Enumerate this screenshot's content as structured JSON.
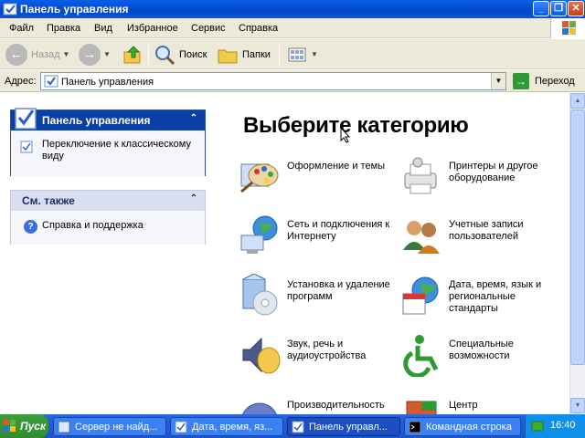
{
  "window": {
    "title": "Панель управления",
    "controls": {
      "minimize": "_",
      "maximize": "❐",
      "close": "✕"
    }
  },
  "menu": [
    "Файл",
    "Правка",
    "Вид",
    "Избранное",
    "Сервис",
    "Справка"
  ],
  "toolbar": {
    "back": "Назад",
    "search": "Поиск",
    "folders": "Папки"
  },
  "address": {
    "label": "Адрес:",
    "value": "Панель управления",
    "go": "Переход"
  },
  "left": {
    "panel": {
      "title": "Панель управления",
      "link": "Переключение к классическому виду"
    },
    "see_also": {
      "title": "См. также",
      "link": "Справка и поддержка"
    }
  },
  "main": {
    "heading": "Выберите категорию",
    "categories": [
      {
        "label": "Оформление и темы",
        "icon": "appearance-themes-icon"
      },
      {
        "label": "Принтеры и другое оборудование",
        "icon": "printers-hardware-icon"
      },
      {
        "label": "Сеть и подключения к Интернету",
        "icon": "network-internet-icon"
      },
      {
        "label": "Учетные записи пользователей",
        "icon": "user-accounts-icon"
      },
      {
        "label": "Установка и удаление программ",
        "icon": "add-remove-programs-icon"
      },
      {
        "label": "Дата, время, язык и региональные стандарты",
        "icon": "date-time-region-icon"
      },
      {
        "label": "Звук, речь и аудиоустройства",
        "icon": "sound-speech-icon"
      },
      {
        "label": "Специальные возможности",
        "icon": "accessibility-icon"
      },
      {
        "label": "Производительность",
        "icon": "performance-icon"
      },
      {
        "label": "Центр",
        "icon": "security-center-icon"
      }
    ]
  },
  "taskbar": {
    "start": "Пуск",
    "tasks": [
      {
        "label": "Сервер не найд...",
        "active": false
      },
      {
        "label": "Дата, время, яз...",
        "active": false
      },
      {
        "label": "Панель управл...",
        "active": true
      },
      {
        "label": "Командная строка",
        "active": false
      }
    ],
    "clock": "16:40"
  },
  "colors": {
    "titlebar": "#0348c8",
    "panel_header": "#0a3fa6",
    "taskbar": "#245edb",
    "start": "#2f8d2f"
  }
}
